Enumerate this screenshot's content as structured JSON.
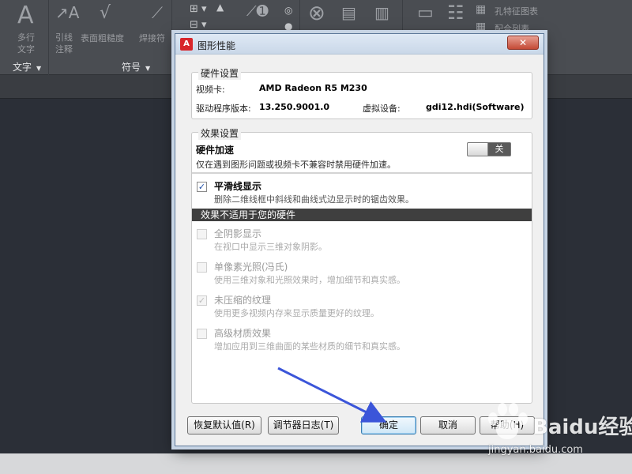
{
  "ribbon": {
    "text_panel_label": "文字",
    "symbol_panel_label": "符号",
    "multiline_text_label": "多行\n文字",
    "leader_label": "引线\n注释",
    "surface_roughness_label": "表面粗糙度",
    "welding_symbol_label": "焊接符",
    "hole_feature_label": "孔特征图表",
    "mating_list_label": "配合列表"
  },
  "dialog": {
    "title": "图形性能",
    "close_label": "✕",
    "hardware": {
      "legend": "硬件设置",
      "video_card_label": "视频卡:",
      "video_card_value": "AMD Radeon R5 M230",
      "driver_label": "驱动程序版本:",
      "driver_value": "13.250.9001.0",
      "virtual_device_label": "虚拟设备:",
      "virtual_device_value": "gdi12.hdi(Software)"
    },
    "effects": {
      "legend": "效果设置",
      "hw_accel_title": "硬件加速",
      "hw_accel_desc": "仅在遇到图形问题或视频卡不兼容时禁用硬件加速。",
      "toggle_label": "关",
      "toggle_on": false,
      "smooth_title": "平滑线显示",
      "smooth_desc": "删除二维线框中斜线和曲线式边显示时的锯齿效果。",
      "smooth_checked": true,
      "na_header": "效果不适用于您的硬件",
      "options": [
        {
          "title": "全阴影显示",
          "desc": "在视口中显示三维对象阴影。",
          "checked": false
        },
        {
          "title": "单像素光照(冯氏)",
          "desc": "使用三维对象和光照效果时，增加细节和真实感。",
          "checked": false
        },
        {
          "title": "未压缩的纹理",
          "desc": "使用更多视频内存来显示质量更好的纹理。",
          "checked": true
        },
        {
          "title": "高级材质效果",
          "desc": "增加应用到三维曲面的某些材质的细节和真实感。",
          "checked": false
        }
      ]
    },
    "buttons": {
      "restore_defaults": "恢复默认值(R)",
      "tuner_log": "调节器日志(T)",
      "ok": "确定",
      "cancel": "取消",
      "help": "帮助(H)"
    }
  },
  "check_glyph": "✓",
  "watermark": {
    "brand": "Baidu经验",
    "url": "jingyan.baidu.com"
  },
  "colors": {
    "annotation_arrow": "#3b55d9",
    "toggle_off": "#5a5a5a",
    "na_header_bg": "#3f3f3f"
  }
}
